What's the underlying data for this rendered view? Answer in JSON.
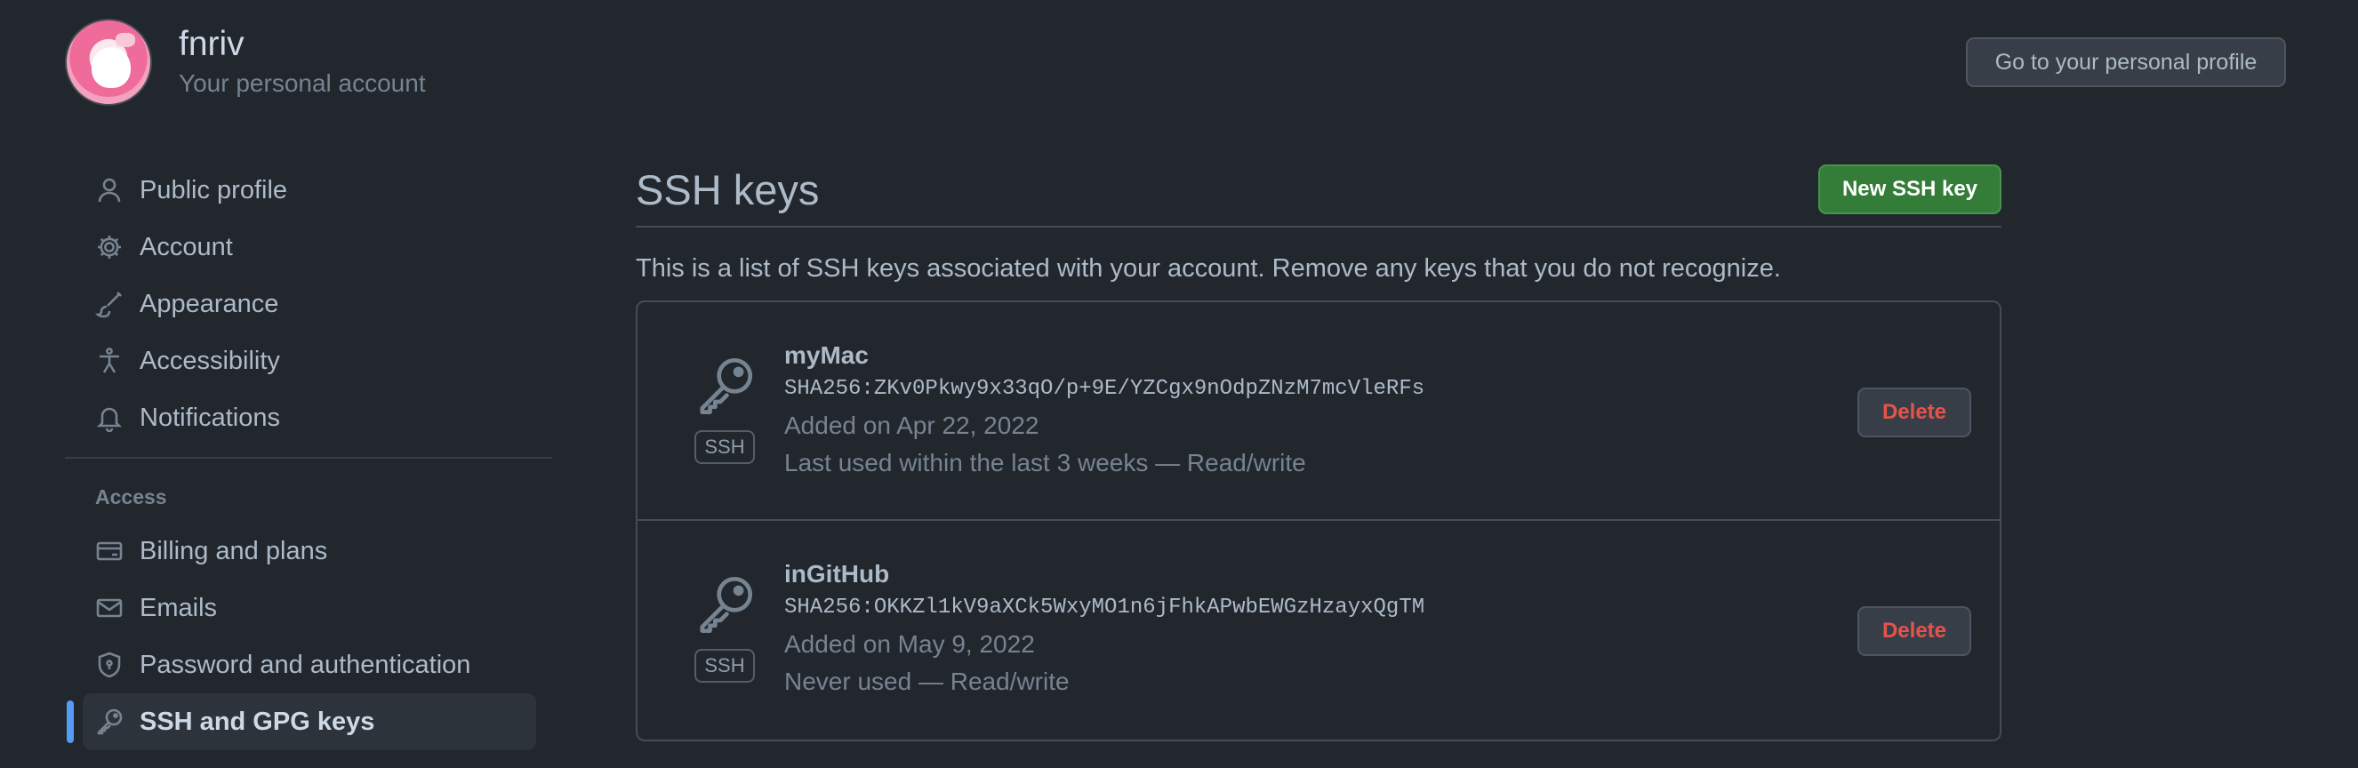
{
  "header": {
    "username": "fnriv",
    "subtitle": "Your personal account",
    "profile_button": "Go to your personal profile"
  },
  "sidebar": {
    "items": [
      {
        "label": "Public profile",
        "icon": "person-icon"
      },
      {
        "label": "Account",
        "icon": "gear-icon"
      },
      {
        "label": "Appearance",
        "icon": "paintbrush-icon"
      },
      {
        "label": "Accessibility",
        "icon": "accessibility-icon"
      },
      {
        "label": "Notifications",
        "icon": "bell-icon"
      }
    ],
    "access_label": "Access",
    "access_items": [
      {
        "label": "Billing and plans",
        "icon": "credit-card-icon"
      },
      {
        "label": "Emails",
        "icon": "mail-icon"
      },
      {
        "label": "Password and authentication",
        "icon": "shield-lock-icon"
      },
      {
        "label": "SSH and GPG keys",
        "icon": "key-icon",
        "active": true
      }
    ]
  },
  "main": {
    "title": "SSH keys",
    "new_button": "New SSH key",
    "description": "This is a list of SSH keys associated with your account. Remove any keys that you do not recognize.",
    "keys": [
      {
        "name": "myMac",
        "fingerprint": "SHA256:ZKv0Pkwy9x33qO/p+9E/YZCgx9nOdpZNzM7mcVleRFs",
        "added": "Added on Apr 22, 2022",
        "usage": "Last used within the last 3 weeks — Read/write",
        "badge": "SSH",
        "delete_label": "Delete"
      },
      {
        "name": "inGitHub",
        "fingerprint": "SHA256:OKKZl1kV9aXCk5WxyMO1n6jFhkAPwbEWGzHzayxQgTM",
        "added": "Added on May 9, 2022",
        "usage": "Never used — Read/write",
        "badge": "SSH",
        "delete_label": "Delete"
      }
    ]
  },
  "colors": {
    "background": "#22272e",
    "accent": "#539bf5",
    "primary_button": "#347d39",
    "danger": "#e5534b"
  }
}
